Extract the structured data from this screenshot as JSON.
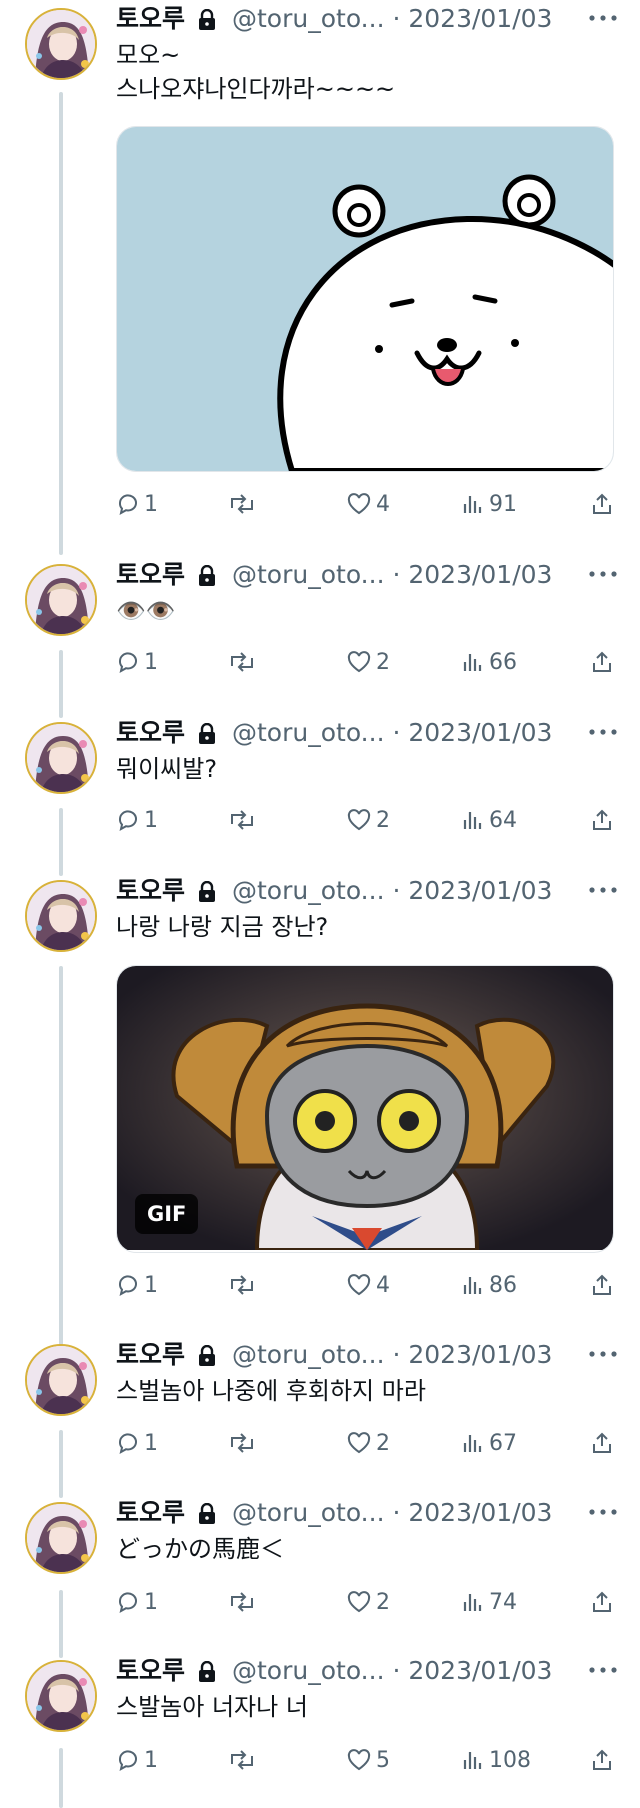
{
  "colors": {
    "text": "#0f1419",
    "muted": "#536471",
    "thread_line": "#cfd9de",
    "media_bg": "#b8d4e0"
  },
  "tweets": [
    {
      "name": "토오루",
      "handle": "@toru_oto... · 2023/01/03",
      "text": "모오~\n스나오쟈나인다까라~~~~",
      "media": "image",
      "stats": {
        "replies": "1",
        "likes": "4",
        "views": "91"
      }
    },
    {
      "name": "토오루",
      "handle": "@toru_oto... · 2023/01/03",
      "text": "👁️👁️",
      "media": null,
      "stats": {
        "replies": "1",
        "likes": "2",
        "views": "66"
      }
    },
    {
      "name": "토오루",
      "handle": "@toru_oto... · 2023/01/03",
      "text": "뭐이씨발?",
      "media": null,
      "stats": {
        "replies": "1",
        "likes": "2",
        "views": "64"
      }
    },
    {
      "name": "토오루",
      "handle": "@toru_oto... · 2023/01/03",
      "text": "나랑 나랑 지금 장난?",
      "media": "gif",
      "gif_label": "GIF",
      "stats": {
        "replies": "1",
        "likes": "4",
        "views": "86"
      }
    },
    {
      "name": "토오루",
      "handle": "@toru_oto... · 2023/01/03",
      "text": "스벌놈아 나중에 후회하지 마라",
      "media": null,
      "stats": {
        "replies": "1",
        "likes": "2",
        "views": "67"
      }
    },
    {
      "name": "토오루",
      "handle": "@toru_oto... · 2023/01/03",
      "text": "どっかの馬鹿＜",
      "media": null,
      "stats": {
        "replies": "1",
        "likes": "2",
        "views": "74"
      }
    },
    {
      "name": "토오루",
      "handle": "@toru_oto... · 2023/01/03",
      "text": "스발놈아 너자나 너",
      "media": null,
      "stats": {
        "replies": "1",
        "likes": "5",
        "views": "108"
      }
    }
  ]
}
